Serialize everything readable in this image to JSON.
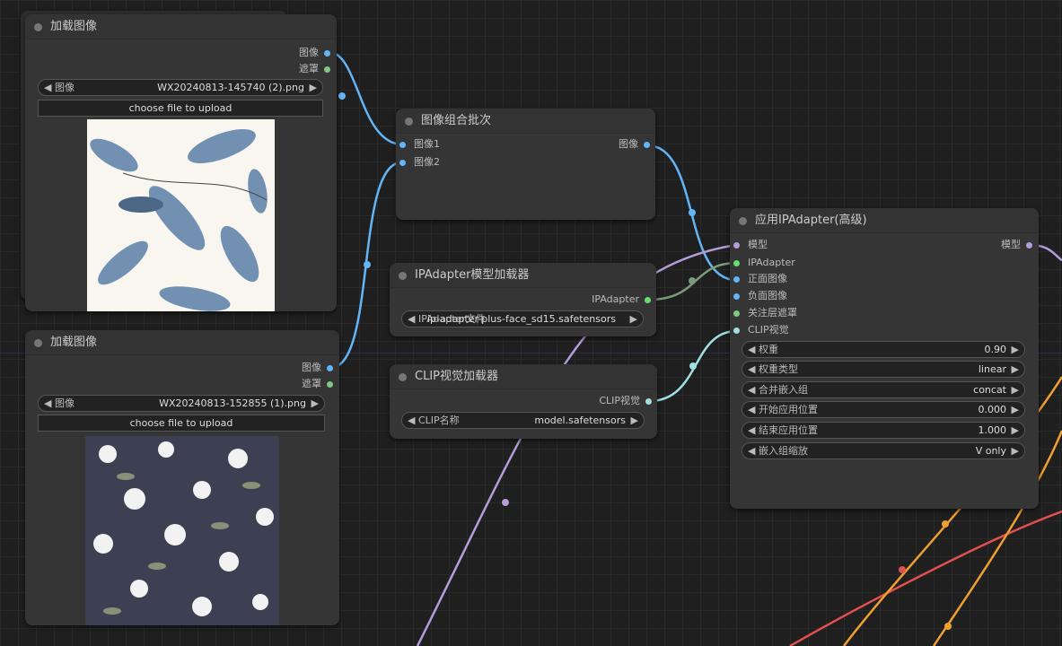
{
  "load_image_1": {
    "title": "加载图像",
    "outputs": [
      "图像",
      "遮罩"
    ],
    "combo_label": "图像",
    "combo_value": "WX20240813-145740 (2).png",
    "upload_label": "choose file to upload"
  },
  "load_image_2": {
    "title": "加载图像",
    "outputs": [
      "图像",
      "遮罩"
    ],
    "combo_label": "图像",
    "combo_value": "WX20240813-152855 (1).png",
    "upload_label": "choose file to upload"
  },
  "batch": {
    "title": "图像组合批次",
    "inputs": [
      "图像1",
      "图像2"
    ],
    "output": "图像"
  },
  "ipa_loader": {
    "title": "IPAdapter模型加载器",
    "output": "IPAdapter",
    "combo_label": "IPAdapter文件",
    "combo_value": "ip-adapter-plus-face_sd15.safetensors"
  },
  "clip_loader": {
    "title": "CLIP视觉加载器",
    "output": "CLIP视觉",
    "combo_label": "CLIP名称",
    "combo_value": "model.safetensors"
  },
  "apply": {
    "title": "应用IPAdapter(高级)",
    "inputs": [
      "模型",
      "IPAdapter",
      "正面图像",
      "负面图像",
      "关注层遮罩",
      "CLIP视觉"
    ],
    "output": "模型",
    "widgets": [
      {
        "label": "权重",
        "value": "0.90"
      },
      {
        "label": "权重类型",
        "value": "linear"
      },
      {
        "label": "合并嵌入组",
        "value": "concat"
      },
      {
        "label": "开始应用位置",
        "value": "0.000"
      },
      {
        "label": "结束应用位置",
        "value": "1.000"
      },
      {
        "label": "嵌入组缩放",
        "value": "V only"
      }
    ]
  },
  "colors": {
    "image": "#64b5f6",
    "mask": "#81c784",
    "model": "#b39ddb",
    "ipadapter": "#66e066",
    "clip_vision": "#a0e0e0",
    "orange": "#f0a030",
    "red": "#e05050"
  }
}
